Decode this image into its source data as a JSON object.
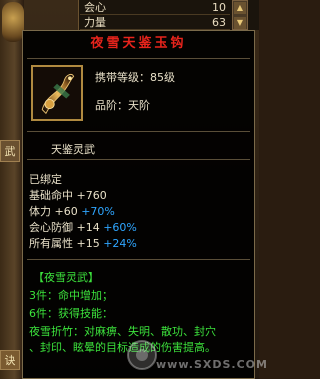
{
  "background": {
    "rows": [
      {
        "label": "会心",
        "value": "10"
      },
      {
        "label": "力量",
        "value": "63"
      }
    ],
    "left_tab": "武",
    "left_tab_bottom": "诀"
  },
  "tooltip": {
    "title": "夜雪天鉴玉钩",
    "level_label": "携带等级：85级",
    "grade_label": "品阶：天阶",
    "subname": "天鉴灵武",
    "bound": "已绑定",
    "stats": [
      {
        "label": "基础命中",
        "value": "+760",
        "pct": ""
      },
      {
        "label": "体力",
        "value": "+60",
        "pct": "+70%"
      },
      {
        "label": "会心防御",
        "value": "+14",
        "pct": "+60%"
      },
      {
        "label": "所有属性",
        "value": "+15",
        "pct": "+24%"
      }
    ],
    "set": {
      "title": "【夜雪灵武】",
      "lines": [
        "3件：命中增加；",
        "6件：获得技能：",
        "夜雪折竹：对麻痹、失明、散功、封穴",
        "、封印、眩晕的目标造成的伤害提高。"
      ]
    },
    "colors": {
      "title": "#e8241c",
      "percent": "#2fa6ff",
      "set": "#3ce23c"
    }
  },
  "watermark": "www.SXDS.COM"
}
